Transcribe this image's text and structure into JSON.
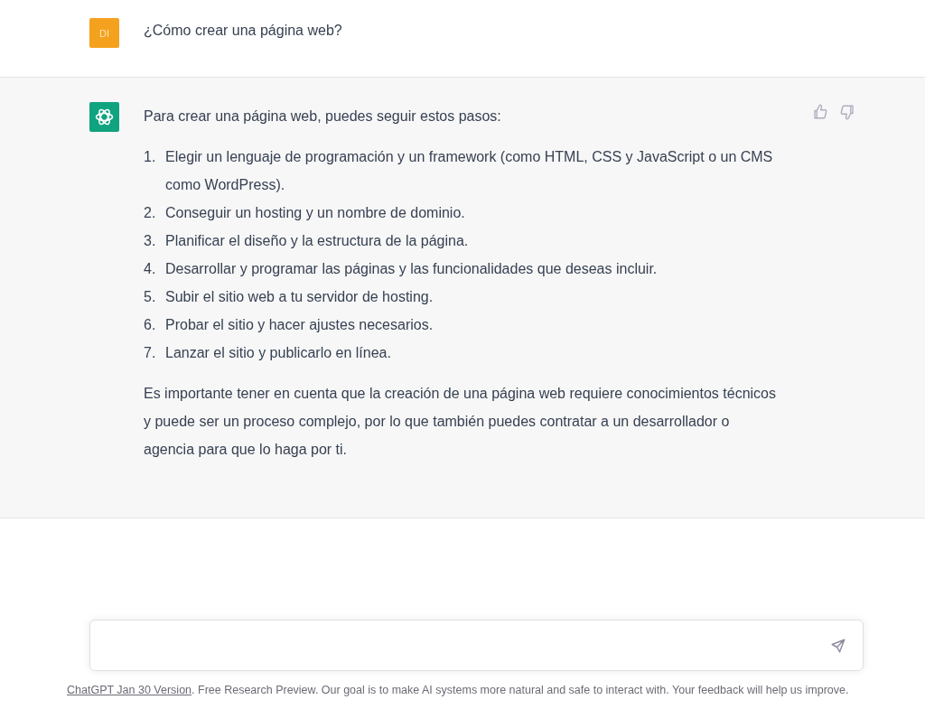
{
  "user_message": {
    "avatar_initials": "DI",
    "text": "¿Cómo crear una página web?"
  },
  "assistant_message": {
    "intro": "Para crear una página web, puedes seguir estos pasos:",
    "steps": [
      {
        "number": "1.",
        "text": "Elegir un lenguaje de programación y un framework (como HTML, CSS y JavaScript o un CMS como WordPress)."
      },
      {
        "number": "2.",
        "text": "Conseguir un hosting y un nombre de dominio."
      },
      {
        "number": "3.",
        "text": "Planificar el diseño y la estructura de la página."
      },
      {
        "number": "4.",
        "text": "Desarrollar y programar las páginas y las funcionalidades que deseas incluir."
      },
      {
        "number": "5.",
        "text": "Subir el sitio web a tu servidor de hosting."
      },
      {
        "number": "6.",
        "text": "Probar el sitio y hacer ajustes necesarios."
      },
      {
        "number": "7.",
        "text": "Lanzar el sitio y publicarlo en línea."
      }
    ],
    "conclusion": "Es importante tener en cuenta que la creación de una página web requiere conocimientos técnicos y puede ser un proceso complejo, por lo que también puedes contratar a un desarrollador o agencia para que lo haga por ti."
  },
  "footer": {
    "link": "ChatGPT Jan 30 Version",
    "text": ". Free Research Preview. Our goal is to make AI systems more natural and safe to interact with. Your feedback will help us improve."
  }
}
